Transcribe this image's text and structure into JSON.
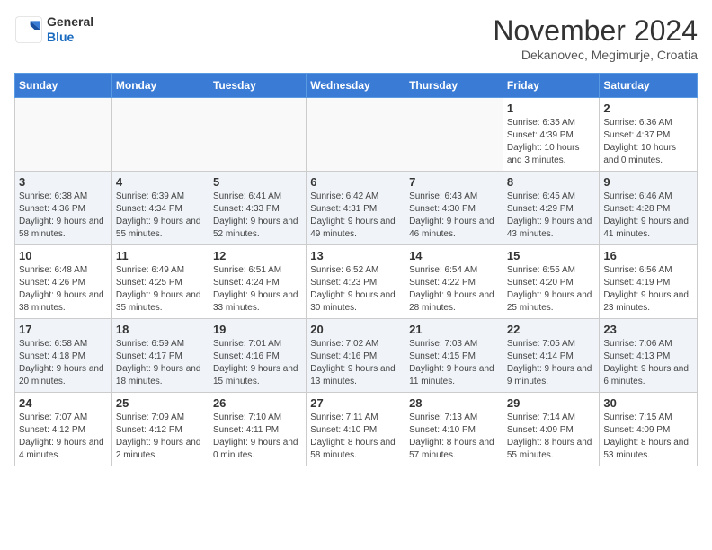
{
  "header": {
    "logo_general": "General",
    "logo_blue": "Blue",
    "month_title": "November 2024",
    "subtitle": "Dekanovec, Megimurje, Croatia"
  },
  "days_of_week": [
    "Sunday",
    "Monday",
    "Tuesday",
    "Wednesday",
    "Thursday",
    "Friday",
    "Saturday"
  ],
  "weeks": [
    [
      {
        "day": "",
        "info": ""
      },
      {
        "day": "",
        "info": ""
      },
      {
        "day": "",
        "info": ""
      },
      {
        "day": "",
        "info": ""
      },
      {
        "day": "",
        "info": ""
      },
      {
        "day": "1",
        "info": "Sunrise: 6:35 AM\nSunset: 4:39 PM\nDaylight: 10 hours and 3 minutes."
      },
      {
        "day": "2",
        "info": "Sunrise: 6:36 AM\nSunset: 4:37 PM\nDaylight: 10 hours and 0 minutes."
      }
    ],
    [
      {
        "day": "3",
        "info": "Sunrise: 6:38 AM\nSunset: 4:36 PM\nDaylight: 9 hours and 58 minutes."
      },
      {
        "day": "4",
        "info": "Sunrise: 6:39 AM\nSunset: 4:34 PM\nDaylight: 9 hours and 55 minutes."
      },
      {
        "day": "5",
        "info": "Sunrise: 6:41 AM\nSunset: 4:33 PM\nDaylight: 9 hours and 52 minutes."
      },
      {
        "day": "6",
        "info": "Sunrise: 6:42 AM\nSunset: 4:31 PM\nDaylight: 9 hours and 49 minutes."
      },
      {
        "day": "7",
        "info": "Sunrise: 6:43 AM\nSunset: 4:30 PM\nDaylight: 9 hours and 46 minutes."
      },
      {
        "day": "8",
        "info": "Sunrise: 6:45 AM\nSunset: 4:29 PM\nDaylight: 9 hours and 43 minutes."
      },
      {
        "day": "9",
        "info": "Sunrise: 6:46 AM\nSunset: 4:28 PM\nDaylight: 9 hours and 41 minutes."
      }
    ],
    [
      {
        "day": "10",
        "info": "Sunrise: 6:48 AM\nSunset: 4:26 PM\nDaylight: 9 hours and 38 minutes."
      },
      {
        "day": "11",
        "info": "Sunrise: 6:49 AM\nSunset: 4:25 PM\nDaylight: 9 hours and 35 minutes."
      },
      {
        "day": "12",
        "info": "Sunrise: 6:51 AM\nSunset: 4:24 PM\nDaylight: 9 hours and 33 minutes."
      },
      {
        "day": "13",
        "info": "Sunrise: 6:52 AM\nSunset: 4:23 PM\nDaylight: 9 hours and 30 minutes."
      },
      {
        "day": "14",
        "info": "Sunrise: 6:54 AM\nSunset: 4:22 PM\nDaylight: 9 hours and 28 minutes."
      },
      {
        "day": "15",
        "info": "Sunrise: 6:55 AM\nSunset: 4:20 PM\nDaylight: 9 hours and 25 minutes."
      },
      {
        "day": "16",
        "info": "Sunrise: 6:56 AM\nSunset: 4:19 PM\nDaylight: 9 hours and 23 minutes."
      }
    ],
    [
      {
        "day": "17",
        "info": "Sunrise: 6:58 AM\nSunset: 4:18 PM\nDaylight: 9 hours and 20 minutes."
      },
      {
        "day": "18",
        "info": "Sunrise: 6:59 AM\nSunset: 4:17 PM\nDaylight: 9 hours and 18 minutes."
      },
      {
        "day": "19",
        "info": "Sunrise: 7:01 AM\nSunset: 4:16 PM\nDaylight: 9 hours and 15 minutes."
      },
      {
        "day": "20",
        "info": "Sunrise: 7:02 AM\nSunset: 4:16 PM\nDaylight: 9 hours and 13 minutes."
      },
      {
        "day": "21",
        "info": "Sunrise: 7:03 AM\nSunset: 4:15 PM\nDaylight: 9 hours and 11 minutes."
      },
      {
        "day": "22",
        "info": "Sunrise: 7:05 AM\nSunset: 4:14 PM\nDaylight: 9 hours and 9 minutes."
      },
      {
        "day": "23",
        "info": "Sunrise: 7:06 AM\nSunset: 4:13 PM\nDaylight: 9 hours and 6 minutes."
      }
    ],
    [
      {
        "day": "24",
        "info": "Sunrise: 7:07 AM\nSunset: 4:12 PM\nDaylight: 9 hours and 4 minutes."
      },
      {
        "day": "25",
        "info": "Sunrise: 7:09 AM\nSunset: 4:12 PM\nDaylight: 9 hours and 2 minutes."
      },
      {
        "day": "26",
        "info": "Sunrise: 7:10 AM\nSunset: 4:11 PM\nDaylight: 9 hours and 0 minutes."
      },
      {
        "day": "27",
        "info": "Sunrise: 7:11 AM\nSunset: 4:10 PM\nDaylight: 8 hours and 58 minutes."
      },
      {
        "day": "28",
        "info": "Sunrise: 7:13 AM\nSunset: 4:10 PM\nDaylight: 8 hours and 57 minutes."
      },
      {
        "day": "29",
        "info": "Sunrise: 7:14 AM\nSunset: 4:09 PM\nDaylight: 8 hours and 55 minutes."
      },
      {
        "day": "30",
        "info": "Sunrise: 7:15 AM\nSunset: 4:09 PM\nDaylight: 8 hours and 53 minutes."
      }
    ]
  ]
}
